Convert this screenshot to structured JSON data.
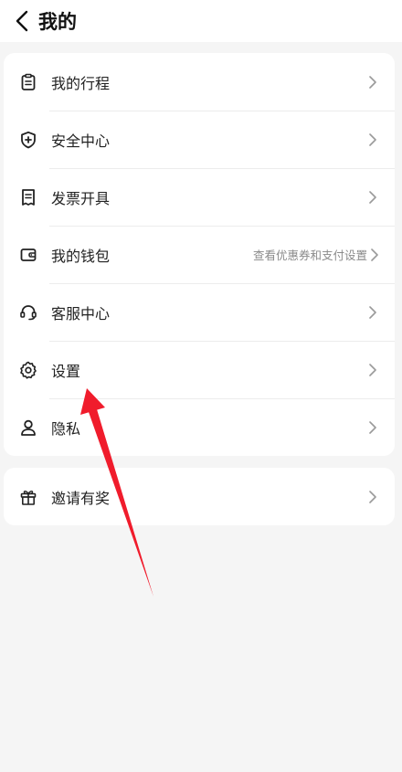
{
  "header": {
    "title": "我的",
    "back_icon": "chevron-left-icon"
  },
  "menu": {
    "items": [
      {
        "label": "我的行程",
        "icon": "clipboard-icon",
        "hint": ""
      },
      {
        "label": "安全中心",
        "icon": "shield-plus-icon",
        "hint": ""
      },
      {
        "label": "发票开具",
        "icon": "receipt-icon",
        "hint": ""
      },
      {
        "label": "我的钱包",
        "icon": "wallet-icon",
        "hint": "查看优惠券和支付设置"
      },
      {
        "label": "客服中心",
        "icon": "headset-icon",
        "hint": ""
      },
      {
        "label": "设置",
        "icon": "gear-icon",
        "hint": ""
      },
      {
        "label": "隐私",
        "icon": "person-icon",
        "hint": ""
      }
    ]
  },
  "invite": {
    "label": "邀请有奖",
    "icon": "gift-icon"
  },
  "colors": {
    "background": "#f5f5f5",
    "card": "#ffffff",
    "annotation_arrow": "#f01c2c"
  }
}
